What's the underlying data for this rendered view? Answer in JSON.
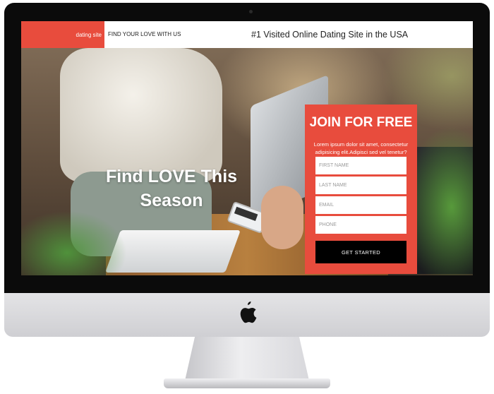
{
  "header": {
    "brand": "dating site",
    "tagline": "FIND YOUR LOVE WITH US",
    "headline": "#1 Visited Online Dating Site in the USA"
  },
  "hero": {
    "heading": "Find LOVE This Season"
  },
  "signup": {
    "title": "JOIN FOR FREE",
    "description": "Lorem ipsum dolor sit amet, consectetur adipisicing elit.Adipisci sed vel tenetur?",
    "fields": {
      "first_name": "FIRST NAME",
      "last_name": "LAST NAME",
      "email": "EMAIL",
      "phone": "PHONE"
    },
    "submit_label": "GET STARTED"
  },
  "colors": {
    "accent": "#e84c3d",
    "button": "#000000",
    "text_on_accent": "#ffffff"
  },
  "icons": {
    "device_logo": "apple-logo-icon"
  }
}
